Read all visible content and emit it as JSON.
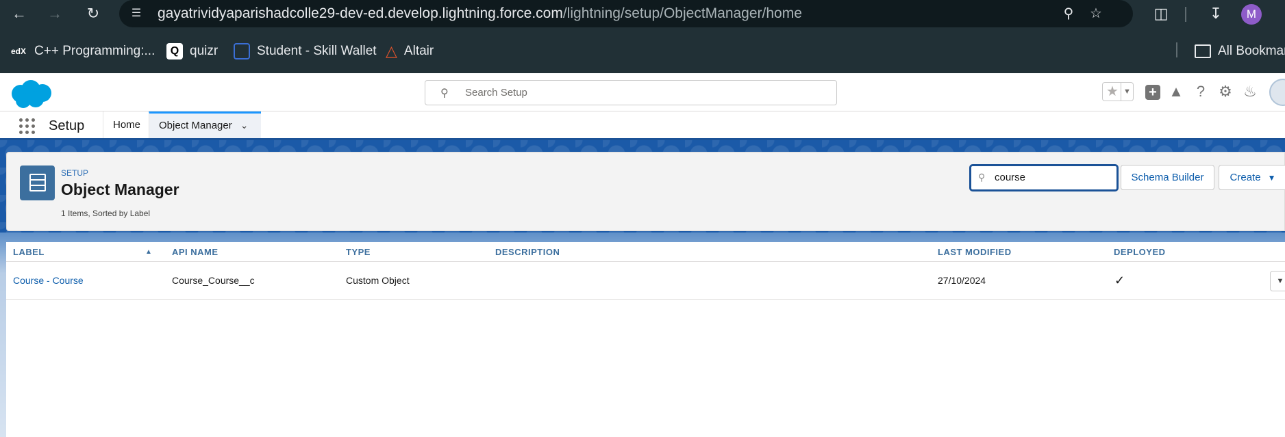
{
  "browser": {
    "url_host": "gayatrividyaparishadcolle29-dev-ed.develop.lightning.force.com",
    "url_path": "/lightning/setup/ObjectManager/home",
    "profile_initial": "M"
  },
  "bookmarks": {
    "items": [
      {
        "label": "C++ Programming:...",
        "icon": "edx-icon",
        "icon_text": "edX"
      },
      {
        "label": "quizr",
        "icon": "quizr-icon",
        "icon_text": "Q"
      },
      {
        "label": "Student - Skill Wallet",
        "icon": "skill-wallet-icon"
      },
      {
        "label": "Altair",
        "icon": "altair-icon"
      }
    ],
    "all_bookmarks_label": "All Bookmar"
  },
  "header": {
    "search_placeholder": "Search Setup"
  },
  "setup_nav": {
    "title": "Setup",
    "tabs": [
      {
        "label": "Home",
        "active": false
      },
      {
        "label": "Object Manager",
        "active": true
      }
    ]
  },
  "object_manager": {
    "eyebrow": "SETUP",
    "title": "Object Manager",
    "count_text": "1 Items, Sorted by Label",
    "quick_find_value": "course",
    "schema_builder_label": "Schema Builder",
    "create_label": "Create"
  },
  "table": {
    "columns": [
      "LABEL",
      "API NAME",
      "TYPE",
      "DESCRIPTION",
      "LAST MODIFIED",
      "DEPLOYED"
    ],
    "rows": [
      {
        "label": "Course - Course",
        "api_name": "Course_Course__c",
        "type": "Custom Object",
        "description": "",
        "last_modified": "27/10/2024",
        "deployed": "✓"
      }
    ]
  },
  "colors": {
    "chrome_bg": "#213036",
    "brand_blue": "#1b5297",
    "link_blue": "#0b5cab",
    "header_text": "#3c6f9e"
  }
}
